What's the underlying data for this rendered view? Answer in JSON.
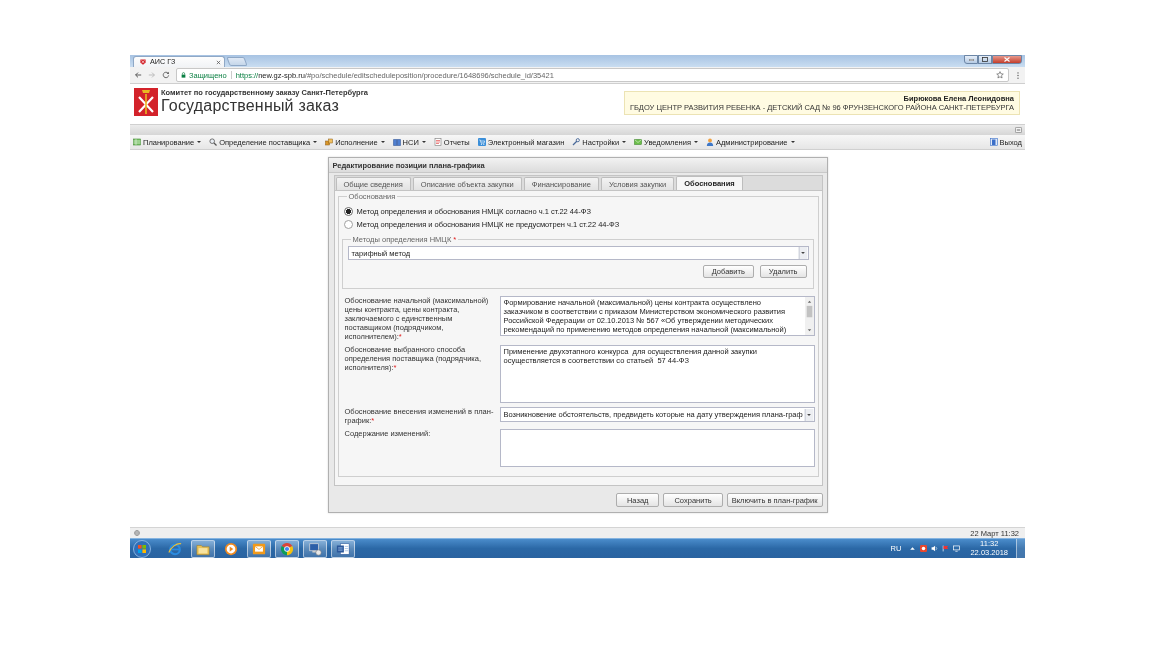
{
  "browser": {
    "tab": {
      "title": "АИС ГЗ"
    },
    "security_label": "Защищено",
    "url": {
      "scheme": "https://",
      "host": "new.gz-spb.ru",
      "path": "/#po/schedule/editscheduleposition/procedure/1648696/schedule_id/35421"
    }
  },
  "header": {
    "org_line": "Комитет по государственному заказу Санкт-Петербурга",
    "title": "Государственный заказ",
    "user": {
      "name": "Бирюкова Елена Леонидовна",
      "organization": "ГБДОУ ЦЕНТР РАЗВИТИЯ РЕБЕНКА - ДЕТСКИЙ САД № 96 ФРУНЗЕНСКОГО РАЙОНА САНКТ-ПЕТЕРБУРГА"
    }
  },
  "menu": {
    "items": [
      {
        "label": "Планирование",
        "dropdown": true
      },
      {
        "label": "Определение поставщика",
        "dropdown": true
      },
      {
        "label": "Исполнение",
        "dropdown": true
      },
      {
        "label": "НСИ",
        "dropdown": true
      },
      {
        "label": "Отчеты",
        "dropdown": false
      },
      {
        "label": "Электронный магазин",
        "dropdown": false
      },
      {
        "label": "Настройки",
        "dropdown": true
      },
      {
        "label": "Уведомления",
        "dropdown": true
      },
      {
        "label": "Администрирование",
        "dropdown": true
      }
    ],
    "logout": "Выход"
  },
  "dialog": {
    "title": "Редактирование позиции плана-графика",
    "tabs": [
      {
        "label": "Общие сведения",
        "selected": false
      },
      {
        "label": "Описание объекта закупки",
        "selected": false
      },
      {
        "label": "Финансирование",
        "selected": false
      },
      {
        "label": "Условия закупки",
        "selected": false
      },
      {
        "label": "Обоснования",
        "selected": true
      }
    ],
    "justification": {
      "legend": "Обоснования",
      "options": [
        {
          "label": "Метод определения и обоснования НМЦК согласно ч.1 ст.22 44-ФЗ",
          "selected": true
        },
        {
          "label": "Метод определения и обоснования НМЦК не предусмотрен ч.1 ст.22 44-ФЗ",
          "selected": false
        }
      ],
      "methods": {
        "legend": "Методы определения НМЦК",
        "required_mark": "*",
        "value": "тарифный метод",
        "buttons": [
          "Добавить",
          "Удалить"
        ]
      },
      "fields": [
        {
          "kind": "textarea",
          "label": "Обоснование начальной (максимальной) цены контракта, цены контракта, заключаемого с единственным поставщиком (подрядчиком, исполнителем):",
          "required_mark": "*",
          "value": "Формирование начальной (максимальной) цены контракта осуществлено заказчиком в соответствии с приказом Министерством экономического развития Российской Федерации от 02.10.2013 № 567 «Об утверждении методических рекомендаций по применению методов определения начальной (максимальной)",
          "scrollbar": true
        },
        {
          "kind": "textarea",
          "label": "Обоснование выбранного способа определения поставщика (подрядчика, исполнителя):",
          "required_mark": "*",
          "value": "Применение двухэтапного конкурса  для осуществления данной закупки осуществляется в соответствии со статьей  57 44-ФЗ",
          "scrollbar": false
        },
        {
          "kind": "select",
          "label": "Обоснование внесения изменений в план-график:",
          "required_mark": "*",
          "value": "Возникновение обстоятельств, предвидеть которые на дату утверждения плана-граф",
          "scrollbar": false
        },
        {
          "kind": "textarea",
          "label": "Содержание изменений:",
          "scrollbar": false
        }
      ]
    },
    "buttons": [
      "Назад",
      "Сохранить",
      "Включить в план-график"
    ]
  },
  "status_bar": {
    "datetime": "22 Март 11:32"
  },
  "taskbar": {
    "apps": [
      {
        "running": false
      },
      {
        "running": true
      },
      {
        "running": false
      },
      {
        "running": true
      },
      {
        "running": true
      },
      {
        "running": true
      },
      {
        "running": true
      }
    ],
    "language": "RU",
    "time": "11:32",
    "date": "22.03.2018"
  }
}
